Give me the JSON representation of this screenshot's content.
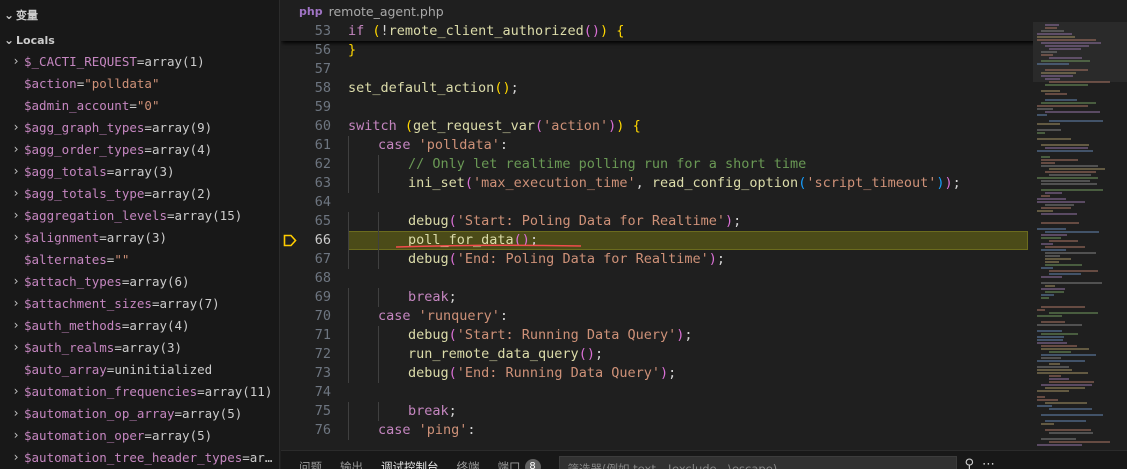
{
  "variables_panel": {
    "title": "变量",
    "section": "Locals",
    "items": [
      {
        "name": "$_CACTI_REQUEST",
        "value": "array(1)",
        "expandable": true,
        "is_string": false
      },
      {
        "name": "$action",
        "value": "\"polldata\"",
        "expandable": false,
        "is_string": true
      },
      {
        "name": "$admin_account",
        "value": "\"0\"",
        "expandable": false,
        "is_string": true
      },
      {
        "name": "$agg_graph_types",
        "value": "array(9)",
        "expandable": true,
        "is_string": false
      },
      {
        "name": "$agg_order_types",
        "value": "array(4)",
        "expandable": true,
        "is_string": false
      },
      {
        "name": "$agg_totals",
        "value": "array(3)",
        "expandable": true,
        "is_string": false
      },
      {
        "name": "$agg_totals_type",
        "value": "array(2)",
        "expandable": true,
        "is_string": false
      },
      {
        "name": "$aggregation_levels",
        "value": "array(15)",
        "expandable": true,
        "is_string": false
      },
      {
        "name": "$alignment",
        "value": "array(3)",
        "expandable": true,
        "is_string": false
      },
      {
        "name": "$alternates",
        "value": "\"\"",
        "expandable": false,
        "is_string": true
      },
      {
        "name": "$attach_types",
        "value": "array(6)",
        "expandable": true,
        "is_string": false
      },
      {
        "name": "$attachment_sizes",
        "value": "array(7)",
        "expandable": true,
        "is_string": false
      },
      {
        "name": "$auth_methods",
        "value": "array(4)",
        "expandable": true,
        "is_string": false
      },
      {
        "name": "$auth_realms",
        "value": "array(3)",
        "expandable": true,
        "is_string": false
      },
      {
        "name": "$auto_array",
        "value": "uninitialized",
        "expandable": false,
        "is_string": false
      },
      {
        "name": "$automation_frequencies",
        "value": "array(11)",
        "expandable": true,
        "is_string": false
      },
      {
        "name": "$automation_op_array",
        "value": "array(5)",
        "expandable": true,
        "is_string": false
      },
      {
        "name": "$automation_oper",
        "value": "array(5)",
        "expandable": true,
        "is_string": false
      },
      {
        "name": "$automation_tree_header_types",
        "value": "ar…",
        "expandable": true,
        "is_string": false
      }
    ]
  },
  "editor": {
    "filename": "remote_agent.php",
    "current_line": "66",
    "lines": [
      {
        "num": "53",
        "indent": 0,
        "tokens": [
          [
            "kw",
            "if "
          ],
          [
            "br1",
            "("
          ],
          [
            "pl",
            "!"
          ],
          [
            "fn",
            "remote_client_authorized"
          ],
          [
            "br2",
            "()"
          ],
          [
            "br1",
            ")"
          ],
          [
            "pl",
            " "
          ],
          [
            "br1",
            "{"
          ]
        ]
      },
      {
        "num": "56",
        "indent": 0,
        "tokens": [
          [
            "br1",
            "}"
          ]
        ]
      },
      {
        "num": "57",
        "indent": 0,
        "tokens": []
      },
      {
        "num": "58",
        "indent": 0,
        "tokens": [
          [
            "fn",
            "set_default_action"
          ],
          [
            "br1",
            "()"
          ],
          [
            "pl",
            ";"
          ]
        ]
      },
      {
        "num": "59",
        "indent": 0,
        "tokens": []
      },
      {
        "num": "60",
        "indent": 0,
        "tokens": [
          [
            "kw",
            "switch "
          ],
          [
            "br1",
            "("
          ],
          [
            "fn",
            "get_request_var"
          ],
          [
            "br2",
            "("
          ],
          [
            "str",
            "'action'"
          ],
          [
            "br2",
            ")"
          ],
          [
            "br1",
            ")"
          ],
          [
            "pl",
            " "
          ],
          [
            "br1",
            "{"
          ]
        ]
      },
      {
        "num": "61",
        "indent": 1,
        "tokens": [
          [
            "kw",
            "case "
          ],
          [
            "str",
            "'polldata'"
          ],
          [
            "pl",
            ":"
          ]
        ]
      },
      {
        "num": "62",
        "indent": 2,
        "tokens": [
          [
            "cm",
            "// Only let realtime polling run for a short time"
          ]
        ]
      },
      {
        "num": "63",
        "indent": 2,
        "tokens": [
          [
            "fn",
            "ini_set"
          ],
          [
            "br2",
            "("
          ],
          [
            "str",
            "'max_execution_time'"
          ],
          [
            "pl",
            ", "
          ],
          [
            "fn",
            "read_config_option"
          ],
          [
            "br3",
            "("
          ],
          [
            "str",
            "'script_timeout'"
          ],
          [
            "br3",
            ")"
          ],
          [
            "br2",
            ")"
          ],
          [
            "pl",
            ";"
          ]
        ]
      },
      {
        "num": "64",
        "indent": 0,
        "tokens": []
      },
      {
        "num": "65",
        "indent": 2,
        "tokens": [
          [
            "fn",
            "debug"
          ],
          [
            "br2",
            "("
          ],
          [
            "str",
            "'Start: Poling Data for Realtime'"
          ],
          [
            "br2",
            ")"
          ],
          [
            "pl",
            ";"
          ]
        ]
      },
      {
        "num": "66",
        "indent": 2,
        "tokens": [
          [
            "fn",
            "poll_for_data"
          ],
          [
            "br2",
            "()"
          ],
          [
            "pl",
            ";"
          ]
        ]
      },
      {
        "num": "67",
        "indent": 2,
        "tokens": [
          [
            "fn",
            "debug"
          ],
          [
            "br2",
            "("
          ],
          [
            "str",
            "'End: Poling Data for Realtime'"
          ],
          [
            "br2",
            ")"
          ],
          [
            "pl",
            ";"
          ]
        ]
      },
      {
        "num": "68",
        "indent": 0,
        "tokens": []
      },
      {
        "num": "69",
        "indent": 2,
        "tokens": [
          [
            "kw",
            "break"
          ],
          [
            "pl",
            ";"
          ]
        ]
      },
      {
        "num": "70",
        "indent": 1,
        "tokens": [
          [
            "kw",
            "case "
          ],
          [
            "str",
            "'runquery'"
          ],
          [
            "pl",
            ":"
          ]
        ]
      },
      {
        "num": "71",
        "indent": 2,
        "tokens": [
          [
            "fn",
            "debug"
          ],
          [
            "br2",
            "("
          ],
          [
            "str",
            "'Start: Running Data Query'"
          ],
          [
            "br2",
            ")"
          ],
          [
            "pl",
            ";"
          ]
        ]
      },
      {
        "num": "72",
        "indent": 2,
        "tokens": [
          [
            "fn",
            "run_remote_data_query"
          ],
          [
            "br2",
            "()"
          ],
          [
            "pl",
            ";"
          ]
        ]
      },
      {
        "num": "73",
        "indent": 2,
        "tokens": [
          [
            "fn",
            "debug"
          ],
          [
            "br2",
            "("
          ],
          [
            "str",
            "'End: Running Data Query'"
          ],
          [
            "br2",
            ")"
          ],
          [
            "pl",
            ";"
          ]
        ]
      },
      {
        "num": "74",
        "indent": 0,
        "tokens": []
      },
      {
        "num": "75",
        "indent": 2,
        "tokens": [
          [
            "kw",
            "break"
          ],
          [
            "pl",
            ";"
          ]
        ]
      },
      {
        "num": "76",
        "indent": 1,
        "tokens": [
          [
            "kw",
            "case "
          ],
          [
            "str",
            "'ping'"
          ],
          [
            "pl",
            ":"
          ]
        ]
      }
    ]
  },
  "panel_tabs": {
    "tabs": [
      "问题",
      "输出",
      "调试控制台",
      "终端",
      "端口"
    ],
    "active": "调试控制台",
    "ports_badge": "8",
    "filter_placeholder": "筛选器(例如 text、!exclude、\\escape)"
  },
  "colors": {
    "accent_highlight": "#4b4b18",
    "squiggle": "#f14c4c",
    "breakpoint_arrow": "#ffcc00"
  }
}
